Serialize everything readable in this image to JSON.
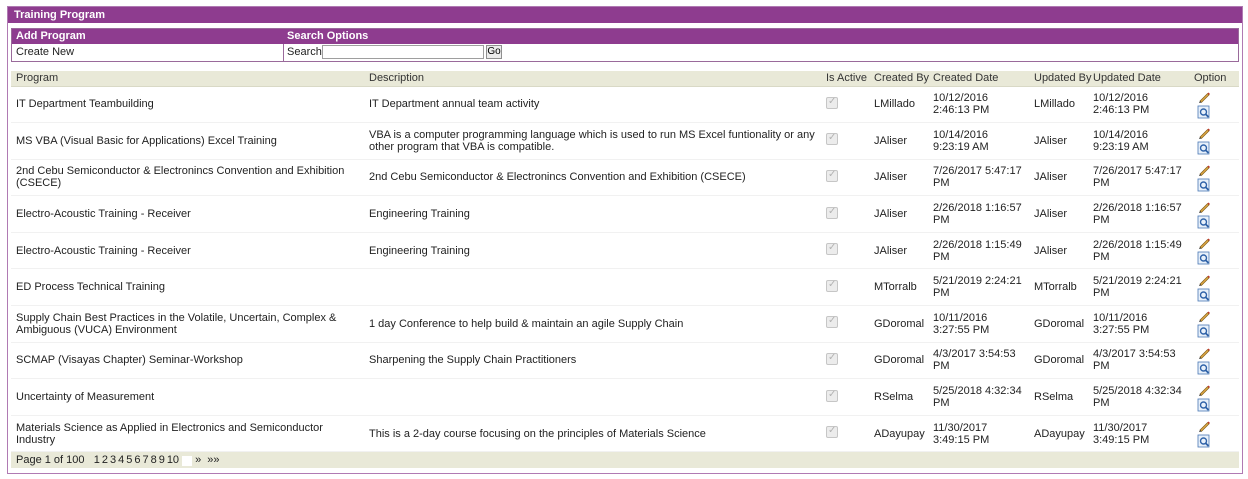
{
  "panel": {
    "title": "Training Program"
  },
  "options": {
    "add_program_label": "Add Program",
    "search_options_label": "Search Options",
    "create_new_label": "Create New",
    "search_label": "Search:",
    "search_value": "",
    "go_label": "Go"
  },
  "columns": [
    "Program",
    "Description",
    "Is Active",
    "Created By",
    "Created Date",
    "Updated By",
    "Updated Date",
    "Option"
  ],
  "rows": [
    {
      "program": "IT Department Teambuilding",
      "description": "IT Department annual team activity",
      "created_by": "LMillado",
      "created_date": "10/12/2016 2:46:13 PM",
      "updated_by": "LMillado",
      "updated_date": "10/12/2016 2:46:13 PM"
    },
    {
      "program": "MS VBA (Visual Basic for Applications) Excel Training",
      "description": "VBA is a computer programming language which is used to run MS Excel funtionality or any other program that VBA is compatible.",
      "created_by": "JAliser",
      "created_date": "10/14/2016 9:23:19 AM",
      "updated_by": "JAliser",
      "updated_date": "10/14/2016 9:23:19 AM"
    },
    {
      "program": "2nd Cebu Semiconductor & Electronincs Convention and Exhibition (CSECE)",
      "description": "2nd Cebu Semiconductor & Electronincs Convention and Exhibition (CSECE)",
      "created_by": "JAliser",
      "created_date": "7/26/2017 5:47:17 PM",
      "updated_by": "JAliser",
      "updated_date": "7/26/2017 5:47:17 PM"
    },
    {
      "program": "Electro-Acoustic Training - Receiver",
      "description": "Engineering Training",
      "created_by": "JAliser",
      "created_date": "2/26/2018 1:16:57 PM",
      "updated_by": "JAliser",
      "updated_date": "2/26/2018 1:16:57 PM"
    },
    {
      "program": "Electro-Acoustic Training - Receiver",
      "description": "Engineering Training",
      "created_by": "JAliser",
      "created_date": "2/26/2018 1:15:49 PM",
      "updated_by": "JAliser",
      "updated_date": "2/26/2018 1:15:49 PM"
    },
    {
      "program": "ED Process Technical Training",
      "description": "",
      "created_by": "MTorralb",
      "created_date": "5/21/2019 2:24:21 PM",
      "updated_by": "MTorralb",
      "updated_date": "5/21/2019 2:24:21 PM"
    },
    {
      "program": "Supply Chain Best Practices in the Volatile, Uncertain, Complex & Ambiguous (VUCA) Environment",
      "description": "1 day Conference to help build & maintain an agile Supply Chain",
      "created_by": "GDoromal",
      "created_date": "10/11/2016 3:27:55 PM",
      "updated_by": "GDoromal",
      "updated_date": "10/11/2016 3:27:55 PM"
    },
    {
      "program": "SCMAP (Visayas Chapter) Seminar-Workshop",
      "description": "Sharpening the Supply Chain Practitioners",
      "created_by": "GDoromal",
      "created_date": "4/3/2017 3:54:53 PM",
      "updated_by": "GDoromal",
      "updated_date": "4/3/2017 3:54:53 PM"
    },
    {
      "program": "Uncertainty of Measurement",
      "description": "",
      "created_by": "RSelma",
      "created_date": "5/25/2018 4:32:34 PM",
      "updated_by": "RSelma",
      "updated_date": "5/25/2018 4:32:34 PM"
    },
    {
      "program": "Materials Science as Applied in Electronics and Semiconductor Industry",
      "description": "This is a 2-day course focusing on the principles of Materials Science",
      "created_by": "ADayupay",
      "created_date": "11/30/2017 3:49:15 PM",
      "updated_by": "ADayupay",
      "updated_date": "11/30/2017 3:49:15 PM"
    }
  ],
  "pager": {
    "label": "Page 1 of 100",
    "pages": [
      "1",
      "2",
      "3",
      "4",
      "5",
      "6",
      "7",
      "8",
      "9",
      "10"
    ],
    "next": "»",
    "last": "»»"
  },
  "colors": {
    "header_purple": "#8e3c8f",
    "grid_header": "#e9e9d8"
  },
  "icons": {
    "edit": "pencil-edit-icon",
    "view": "magnifier-view-icon"
  }
}
